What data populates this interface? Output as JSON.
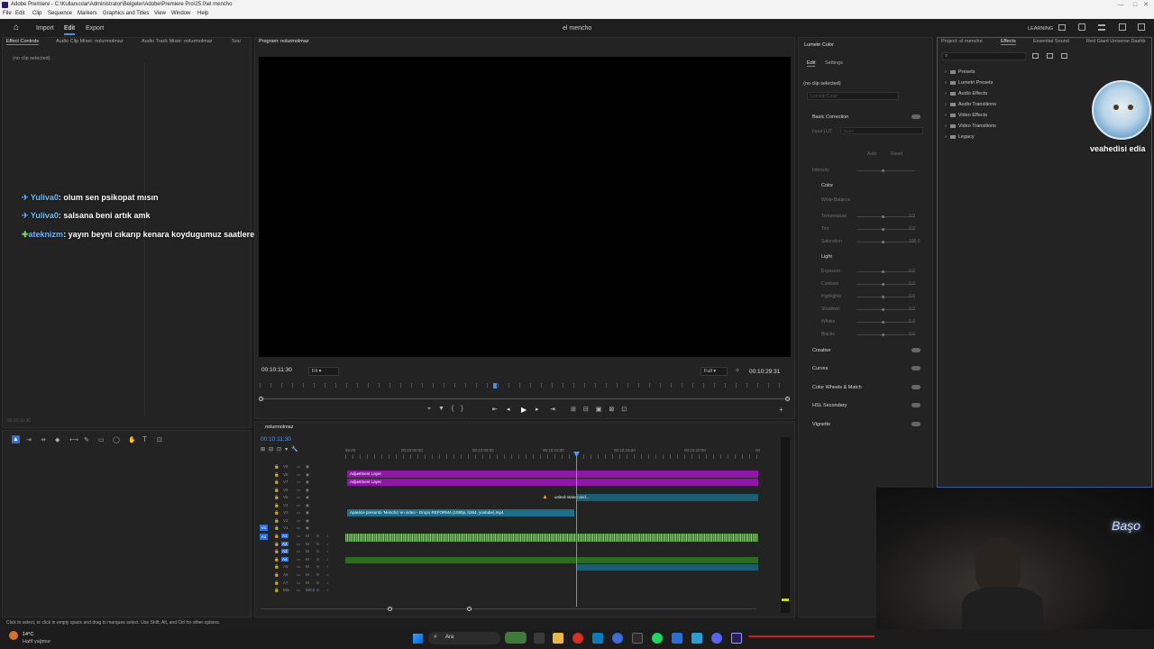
{
  "titlebar": {
    "title": "Adobe Premiere - C:\\Kullanıcılar\\Administrator\\Belgeler\\Adobe\\Premiere Pro\\25.0\\el mencho",
    "controls": [
      "—",
      "□",
      "✕"
    ]
  },
  "menubar": [
    "File",
    "Edit",
    "Clip",
    "Sequence",
    "Markers",
    "Graphics and Titles",
    "View",
    "Window",
    "Help"
  ],
  "header": {
    "nav": [
      "Import",
      "Edit",
      "Export"
    ],
    "project_name": "el mencho",
    "learning": "LEARNING"
  },
  "left_panel": {
    "tabs": [
      "Effect Controls",
      "Audio Clip Mixer: nolurmolmaz",
      "Audio Track Mixer: nolurmolmaz",
      "Sou"
    ],
    "no_clip": "(no clip selected)",
    "timecode": "00:10:11:30"
  },
  "chat": [
    {
      "user": "Yuliva0",
      "message": "olum sen psikopat mısın"
    },
    {
      "user": "Yuliva0",
      "message": "salsana beni artık amk"
    },
    {
      "user": "ateknizm",
      "message": "yayın beyni cıkarıp kenara koydugumuz saatlere gelmiş"
    }
  ],
  "program": {
    "tab": "Program: nolurmolmaz",
    "timecode_left": "00:10:11:30",
    "fit": "Fit",
    "quality": "Full",
    "timecode_right": "00:10:29:31"
  },
  "timeline": {
    "tab": "nolurmolmaz",
    "timecode": "00:10:11:30",
    "ruler": [
      "55:00",
      "00:10:00:00",
      "00:10:05:00",
      "00:10:10:00",
      "00:10:15:00",
      "00:10:20:00",
      "00"
    ],
    "video_tracks": [
      "V9",
      "V8",
      "V7",
      "V6",
      "V5",
      "V4",
      "V3",
      "V2",
      "V1"
    ],
    "audio_tracks": [
      "A1",
      "A2",
      "A3",
      "A4",
      "A5",
      "A6",
      "A7",
      "Mix"
    ],
    "mix_value": "0.0",
    "clips": {
      "adj1": "Adjustment Layer",
      "adj2": "Adjustment Layer",
      "usa": "united-states-and...",
      "main": "Aparece presunto 'Mencho' en video - Grupo REFORMA (1080p, h264, youtube).mp4"
    }
  },
  "lumetri": {
    "tab": "Lumetri Color",
    "subtabs": [
      "Edit",
      "Settings"
    ],
    "no_clip": "(no clip selected)",
    "dropdown": "Lumetri Color",
    "basic": "Basic Correction",
    "input_lut": "Input LUT",
    "lut_value": "None",
    "auto": "Auto",
    "reset": "Reset",
    "intensity": "Intensity",
    "color": "Color",
    "white_balance": "White Balance",
    "color_rows": [
      "Temperature",
      "Tint",
      "Saturation"
    ],
    "color_vals": [
      "0.0",
      "0.0",
      "100.0"
    ],
    "light": "Light",
    "light_rows": [
      "Exposure",
      "Contrast",
      "Highlights",
      "Shadows",
      "Whites",
      "Blacks"
    ],
    "light_vals": [
      "0.0",
      "0.0",
      "0.0",
      "0.0",
      "0.0",
      "0.0"
    ],
    "sections": [
      "Creative",
      "Curves",
      "Color Wheels & Match",
      "HSL Secondary",
      "Vignette"
    ]
  },
  "effects": {
    "tabs": [
      "Project: el mencho",
      "Effects",
      "Essential Sound",
      "Red Giant Universe Dashb"
    ],
    "items": [
      "Presets",
      "Lumetri Presets",
      "Audio Effects",
      "Audio Transitions",
      "Video Effects",
      "Video Transitions",
      "Legacy"
    ]
  },
  "overlay": {
    "cat_caption": "veahedisi edia",
    "cam_text": "Başo"
  },
  "status": "Click to select, or click in empty space and drag to marquee select. Use Shift, Alt, and Ctrl for other options.",
  "taskbar": {
    "weather_temp": "14°C",
    "weather_desc": "Hafif yağmur",
    "search": "Ara"
  }
}
